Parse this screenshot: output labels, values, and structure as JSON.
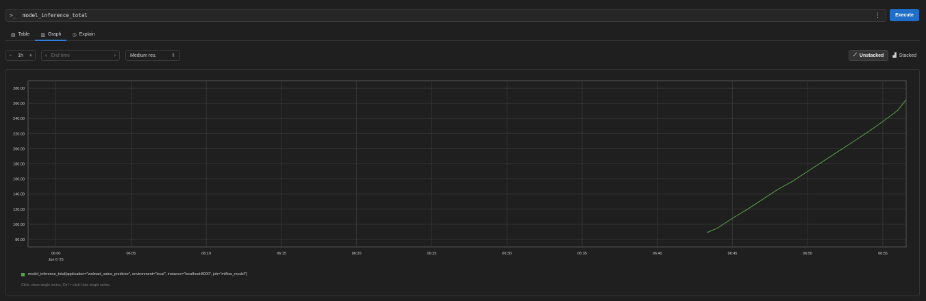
{
  "query": {
    "prompt_icon": ">_",
    "expression": "model_inference_total",
    "menu_icon": "⋮",
    "execute_label": "Execute"
  },
  "tabs": [
    {
      "label": "Table",
      "icon": "table-icon"
    },
    {
      "label": "Graph",
      "icon": "graph-icon"
    },
    {
      "label": "Explain",
      "icon": "explain-icon"
    }
  ],
  "controls": {
    "range_minus": "−",
    "range_value": "1h",
    "range_plus": "+",
    "end_time_placeholder": "End time",
    "resolution": "Medium res.",
    "unstacked_label": "Unstacked",
    "stacked_label": "Stacked"
  },
  "colors": {
    "accent": "#1f6fc9",
    "series": "#5aa64b",
    "grid": "#3a3a3a"
  },
  "chart_data": {
    "type": "line",
    "x_ticks": [
      "06:00",
      "06:05",
      "06:10",
      "06:15",
      "06:20",
      "06:25",
      "06:30",
      "06:35",
      "06:40",
      "06:45",
      "06:50",
      "06:55"
    ],
    "x_tick_sublabel": "Jun 6 '25",
    "y_ticks": [
      "80.00",
      "100.00",
      "120.00",
      "140.00",
      "160.00",
      "180.00",
      "200.00",
      "220.00",
      "240.00",
      "260.00",
      "280.00"
    ],
    "xlim_minutes": [
      -1.85,
      56.55
    ],
    "ylim": [
      70,
      290
    ],
    "series": [
      {
        "name": "model_inference_total{application=\"walmart_sales_predictor\", environment=\"local\", instance=\"localhost:8000\", job=\"mlflow_model\"}",
        "x_minutes": [
          43.3,
          44.0,
          45.0,
          46.0,
          47.0,
          48.0,
          49.0,
          50.0,
          51.0,
          52.0,
          53.0,
          54.0,
          55.0,
          56.0,
          56.55
        ],
        "values": [
          89,
          95,
          108,
          120,
          133,
          146,
          157,
          170,
          183,
          196,
          209,
          222,
          236,
          251,
          265
        ]
      }
    ]
  },
  "legend_hint": "Click: show single series, Ctrl + click: hide single series"
}
